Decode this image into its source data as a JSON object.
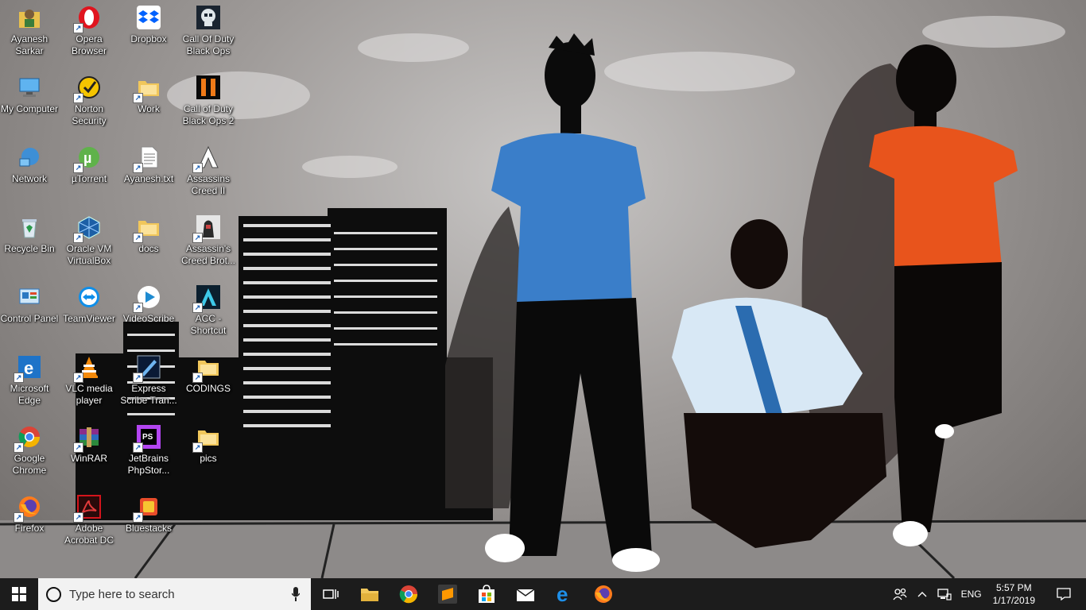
{
  "desktop": {
    "icons": [
      {
        "label": "Ayanesh Sarkar",
        "icon": "user-folder-icon"
      },
      {
        "label": "My Computer",
        "icon": "computer-icon"
      },
      {
        "label": "Network",
        "icon": "network-icon"
      },
      {
        "label": "Recycle Bin",
        "icon": "recycle-bin-icon"
      },
      {
        "label": "Control Panel",
        "icon": "control-panel-icon"
      },
      {
        "label": "Microsoft Edge",
        "icon": "edge-icon"
      },
      {
        "label": "Google Chrome",
        "icon": "chrome-icon"
      },
      {
        "label": "Firefox",
        "icon": "firefox-icon"
      },
      {
        "label": "Opera Browser",
        "icon": "opera-icon"
      },
      {
        "label": "Norton Security",
        "icon": "norton-icon"
      },
      {
        "label": "µTorrent",
        "icon": "utorrent-icon"
      },
      {
        "label": "Oracle VM VirtualBox",
        "icon": "virtualbox-icon"
      },
      {
        "label": "TeamViewer",
        "icon": "teamviewer-icon"
      },
      {
        "label": "VLC media player",
        "icon": "vlc-icon"
      },
      {
        "label": "WinRAR",
        "icon": "winrar-icon"
      },
      {
        "label": "Adobe Acrobat DC",
        "icon": "acrobat-icon"
      },
      {
        "label": "Dropbox",
        "icon": "dropbox-icon"
      },
      {
        "label": "Work",
        "icon": "folder-icon"
      },
      {
        "label": "Ayanesh.txt",
        "icon": "text-file-icon"
      },
      {
        "label": "docs",
        "icon": "folder-icon"
      },
      {
        "label": "VideoScribe",
        "icon": "videoscribe-icon"
      },
      {
        "label": "Express Scribe Tran...",
        "icon": "express-scribe-icon"
      },
      {
        "label": "JetBrains PhpStor...",
        "icon": "phpstorm-icon"
      },
      {
        "label": "Bluestacks",
        "icon": "bluestacks-icon"
      },
      {
        "label": "Call Of Duty Black Ops",
        "icon": "cod-black-ops-icon"
      },
      {
        "label": "Call of Duty Black Ops 2",
        "icon": "cod-black-ops-2-icon"
      },
      {
        "label": "Assassins Creed II",
        "icon": "assassins-creed-icon"
      },
      {
        "label": "Assassin's Creed Brot...",
        "icon": "assassins-creed-brotherhood-icon"
      },
      {
        "label": "ACC - Shortcut",
        "icon": "acc-icon"
      },
      {
        "label": "CODINGS",
        "icon": "folder-icon"
      },
      {
        "label": "pics",
        "icon": "folder-icon"
      }
    ]
  },
  "taskbar": {
    "search_placeholder": "Type here to search",
    "apps": [
      {
        "name": "task-view",
        "icon": "task-view-icon"
      },
      {
        "name": "file-explorer",
        "icon": "folder-icon"
      },
      {
        "name": "chrome",
        "icon": "chrome-icon"
      },
      {
        "name": "sublime-text",
        "icon": "sublime-icon"
      },
      {
        "name": "store",
        "icon": "store-icon"
      },
      {
        "name": "mail",
        "icon": "mail-icon"
      },
      {
        "name": "edge",
        "icon": "edge-icon"
      },
      {
        "name": "firefox",
        "icon": "firefox-icon"
      }
    ],
    "tray": {
      "language": "ENG",
      "time": "5:57 PM",
      "date": "1/17/2019"
    }
  },
  "colors": {
    "taskbar_bg": "#1c1c1c",
    "search_bg": "#f2f2f2",
    "blue_shirt": "#3a7ec9",
    "orange_shirt": "#e8541c"
  }
}
